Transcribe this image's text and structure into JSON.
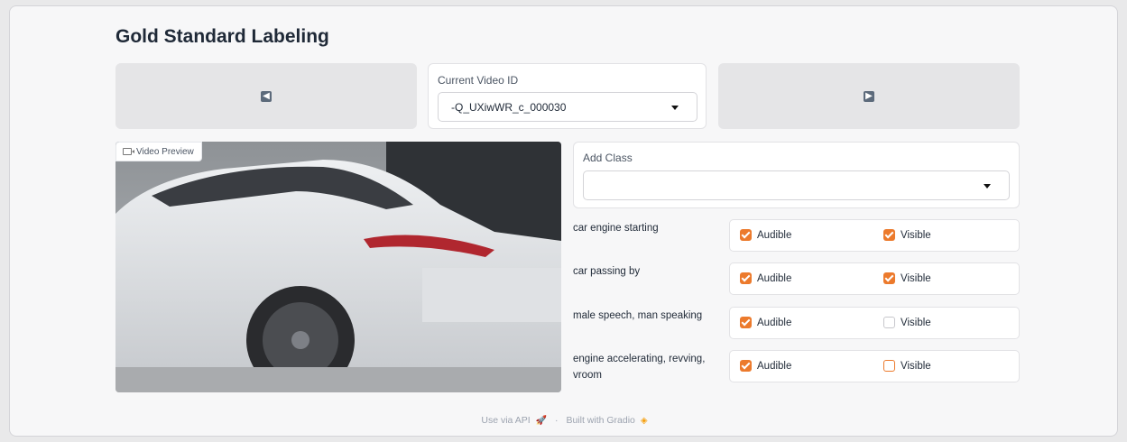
{
  "page": {
    "title": "Gold Standard Labeling"
  },
  "nav": {
    "prev_icon": "left-arrow-icon",
    "next_icon": "right-arrow-icon"
  },
  "video_id": {
    "label": "Current Video ID",
    "value": "-Q_UXiwWR_c_000030"
  },
  "video": {
    "tag": "Video Preview"
  },
  "add_class": {
    "label": "Add Class",
    "value": ""
  },
  "rows": [
    {
      "label": "car engine starting",
      "audible_label": "Audible",
      "audible": true,
      "visible_label": "Visible",
      "visible": true
    },
    {
      "label": "car passing by",
      "audible_label": "Audible",
      "audible": true,
      "visible_label": "Visible",
      "visible": true
    },
    {
      "label": "male speech, man speaking",
      "audible_label": "Audible",
      "audible": true,
      "visible_label": "Visible",
      "visible": false
    },
    {
      "label": "engine accelerating, revving, vroom",
      "audible_label": "Audible",
      "audible": true,
      "visible_label": "Visible",
      "visible": false
    }
  ],
  "footer": {
    "api": "Use via API",
    "sep": "·",
    "built": "Built with Gradio"
  },
  "colors": {
    "accent": "#ec7a2c",
    "panel": "#ffffff",
    "button": "#e5e5e7"
  }
}
